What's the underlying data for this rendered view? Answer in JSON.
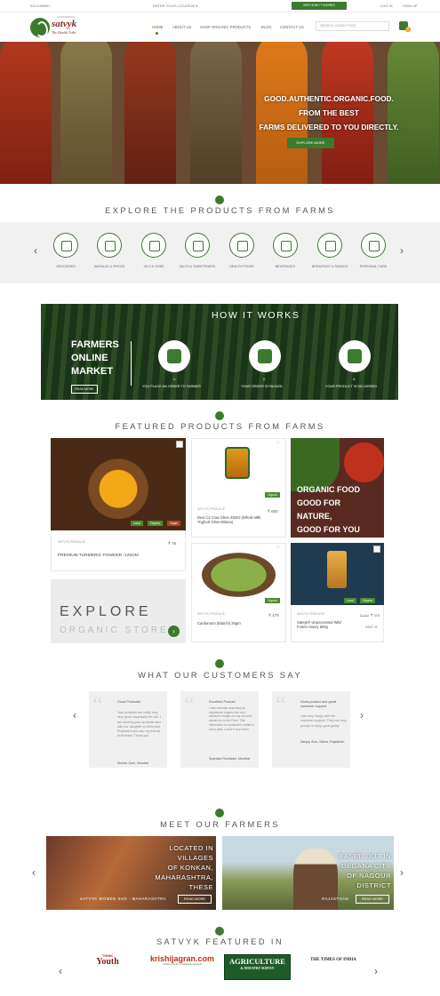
{
  "topbar": {
    "phone": "020-24899H",
    "location": "ENTER YOUR LOCATION ▾",
    "how_it_works": "SEE HOW IT WORKS",
    "login": "LOG IN",
    "signup": "SIGN UP"
  },
  "header": {
    "brand_pre": "AGROGENIUS",
    "brand": "satvyk",
    "tagline": "The Health Tribe",
    "nav": [
      "HOME",
      "ABOUT US",
      "SHOP ORGANIC PRODUCTS",
      "BLOG",
      "CONTACT US"
    ],
    "search_placeholder": "SEARCH GOOD FOOD",
    "cart_count": "0"
  },
  "hero": {
    "line1": "GOOD.AUTHENTIC.ORGANIC.FOOD.",
    "line2": "FROM THE BEST",
    "line3": "FARMS DELIVERED TO YOU DIRECTLY.",
    "button": "EXPLORE MORE"
  },
  "categories": {
    "title": "EXPLORE THE PRODUCTS FROM FARMS",
    "items": [
      {
        "label": "GROCERIES",
        "icon": "groceries-icon"
      },
      {
        "label": "MASALAS & SPICES",
        "icon": "spices-icon"
      },
      {
        "label": "OILS & GHEE",
        "icon": "oil-icon"
      },
      {
        "label": "SALTS & SWEETENERS",
        "icon": "salt-icon"
      },
      {
        "label": "HEALTH FOODS",
        "icon": "health-icon"
      },
      {
        "label": "BEVERAGES",
        "icon": "beverage-icon"
      },
      {
        "label": "BREAKFAST & SNACKS",
        "icon": "breakfast-icon"
      },
      {
        "label": "PERSONAL CARE",
        "icon": "personal-care-icon"
      }
    ]
  },
  "how_it_works": {
    "title": "HOW IT WORKS",
    "tagline_1": "FARMERS",
    "tagline_2": "ONLINE",
    "tagline_3": "MARKET",
    "read_more": "READ MORE",
    "steps": [
      {
        "num": "1.",
        "label": "YOU PLACE AN ORDER TO FARMER"
      },
      {
        "num": "2.",
        "label": "YOUR ORDER IS PACKED"
      },
      {
        "num": "3.",
        "label": "YOUR PRODUCT IS DELIVERED"
      }
    ]
  },
  "featured": {
    "title": "FEATURED PRODUCTS FROM FARMS",
    "turmeric": {
      "brand": "SATVYK PRODUCE",
      "name": "PREMIUM TURMERIC POWDER -125GM",
      "price": "₹ 75",
      "badges": [
        "Local",
        "Organic",
        "Vegan"
      ]
    },
    "ghee": {
      "brand": "SATVYK PRODUCE",
      "name": "Desi Cir Cow Ghee 250ml (Whole Milk Yoghurt Ghee-Bilona)",
      "price": "₹ 600",
      "badge": "Organic"
    },
    "cardamom": {
      "brand": "SATVYK PRODUCE",
      "name": "Cardamom (Elaichi) 25gm",
      "price": "₹ 175",
      "badge": "Organic"
    },
    "honey": {
      "brand": "SATVYK PRODUCE",
      "name": "Satvyk® Unprocessed Wild Forest Honey 500g",
      "price": "₹ 375",
      "old_price": "₹ 400",
      "save": "SAVE 25",
      "badges": [
        "Local",
        "Organic"
      ]
    },
    "organic_banner": {
      "l1": "ORGANIC FOOD",
      "l2": "GOOD FOR",
      "l3": "NATURE,",
      "l4": "GOOD FOR YOU"
    },
    "explore_1": "EXPLORE",
    "explore_2": "ORGANIC STORE",
    "explore_arrow": "›"
  },
  "testimonials": {
    "title": "WHAT OUR CUSTOMERS SAY",
    "items": [
      {
        "heading": "Good Products!",
        "body": "Your products are really very very good, especially the oils. I am drinking your products also with our daughter in Delhi and Ruthveled and also my friends in Mumbai. Thank you.",
        "name": "Suman Goel, Mumbai"
      },
      {
        "heading": "Excellent Product",
        "body": "I was honestly searching for unpolished organic toor dal, I wanted to empty our my son and wasted on to the Farm. This information is explained in detail in every year. Loved it very much.",
        "name": "Spandan Rochwani, Mumbai"
      },
      {
        "heading": "Good product and great customer support",
        "body": "I am very happy with the customer support. They are very prompt in reply. good going.",
        "name": "Sanjay Suni, Sikhar, Rajasthan"
      }
    ]
  },
  "farmers": {
    "title": "MEET OUR FARMERS",
    "items": [
      {
        "text_1": "LOCATED IN",
        "text_2": "VILLAGES",
        "text_3": "OF KONKAN,",
        "text_4": "MAHARASHTRA,",
        "text_5": "THESE",
        "caption": "SATVYK WOMEN SHG - MAHARASHTRA",
        "read": "READ MORE"
      },
      {
        "text_1": "BASED OUT IN",
        "text_2": "DEGANA CITY",
        "text_3": "OF NAGOUR",
        "text_4": "DISTRICT",
        "caption": "RAJASTHAN",
        "read": "READ MORE"
      }
    ]
  },
  "press": {
    "title": "SATVYK FEATURED IN",
    "logos": [
      "Youth",
      "krishijagran.com",
      "AGRICULTURE & INDUSTRY SURVEY",
      "THE TIMES OF INDIA"
    ],
    "youth_pre": "THINK",
    "krishi_sub": "Indian's number 1 Agriculture Network"
  },
  "colors": {
    "accent": "#3c7a2e",
    "brand": "#8a2a1e"
  }
}
